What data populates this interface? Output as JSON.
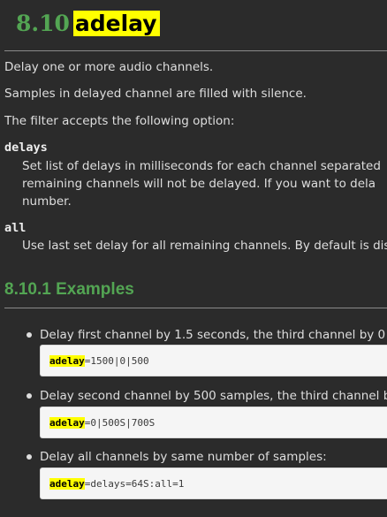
{
  "heading": {
    "number": "8.10",
    "title": "adelay"
  },
  "paragraphs": [
    "Delay one or more audio channels.",
    "Samples in delayed channel are filled with silence.",
    "The filter accepts the following option:"
  ],
  "options": [
    {
      "term": "delays",
      "lines": [
        "Set list of delays in milliseconds for each channel separated",
        "remaining channels will not be delayed. If you want to dela",
        "number."
      ]
    },
    {
      "term": "all",
      "lines": [
        "Use last set delay for all remaining channels. By default is dis"
      ]
    }
  ],
  "subheading": "8.10.1 Examples",
  "examples": [
    {
      "text": "Delay first channel by 1.5 seconds, the third channel by 0",
      "code_keyword": "adelay",
      "code_rest": "=1500|0|500"
    },
    {
      "text": "Delay second channel by 500 samples, the third channel b",
      "code_keyword": "adelay",
      "code_rest": "=0|500S|700S"
    },
    {
      "text": "Delay all channels by same number of samples:",
      "code_keyword": "adelay",
      "code_rest": "=delays=64S:all=1"
    }
  ]
}
